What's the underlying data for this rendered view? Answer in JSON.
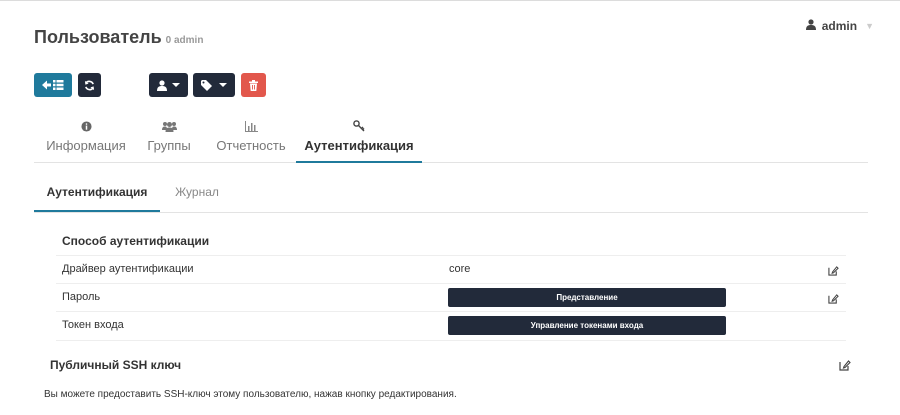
{
  "header": {
    "title": "Пользователь",
    "subtitle": "0 admin",
    "user_menu": {
      "username": "admin"
    }
  },
  "toolbar": {
    "back_icon": "arrow-left-list-icon",
    "refresh_icon": "refresh-icon",
    "user_icon": "user-icon",
    "tag_icon": "tag-icon",
    "delete_icon": "trash-icon"
  },
  "tabs": [
    {
      "label": "Информация",
      "icon": "info-circle-icon",
      "active": false
    },
    {
      "label": "Группы",
      "icon": "users-icon",
      "active": false
    },
    {
      "label": "Отчетность",
      "icon": "bar-chart-icon",
      "active": false
    },
    {
      "label": "Аутентификация",
      "icon": "key-icon",
      "active": true
    }
  ],
  "subtabs": [
    {
      "label": "Аутентификация",
      "active": true
    },
    {
      "label": "Журнал",
      "active": false
    }
  ],
  "auth": {
    "title": "Способ аутентификации",
    "rows": [
      {
        "label": "Драйвер аутентификации",
        "value": "core"
      },
      {
        "label": "Пароль",
        "button": "Представление"
      },
      {
        "label": "Токен входа",
        "button": "Управление токенами входа"
      }
    ]
  },
  "ssh": {
    "title": "Публичный SSH ключ",
    "description": "Вы можете предоставить SSH-ключ этому пользователю, нажав кнопку редактирования."
  },
  "colors": {
    "primary": "#1f7a9c",
    "dark": "#222a3a",
    "danger": "#e2574c"
  }
}
